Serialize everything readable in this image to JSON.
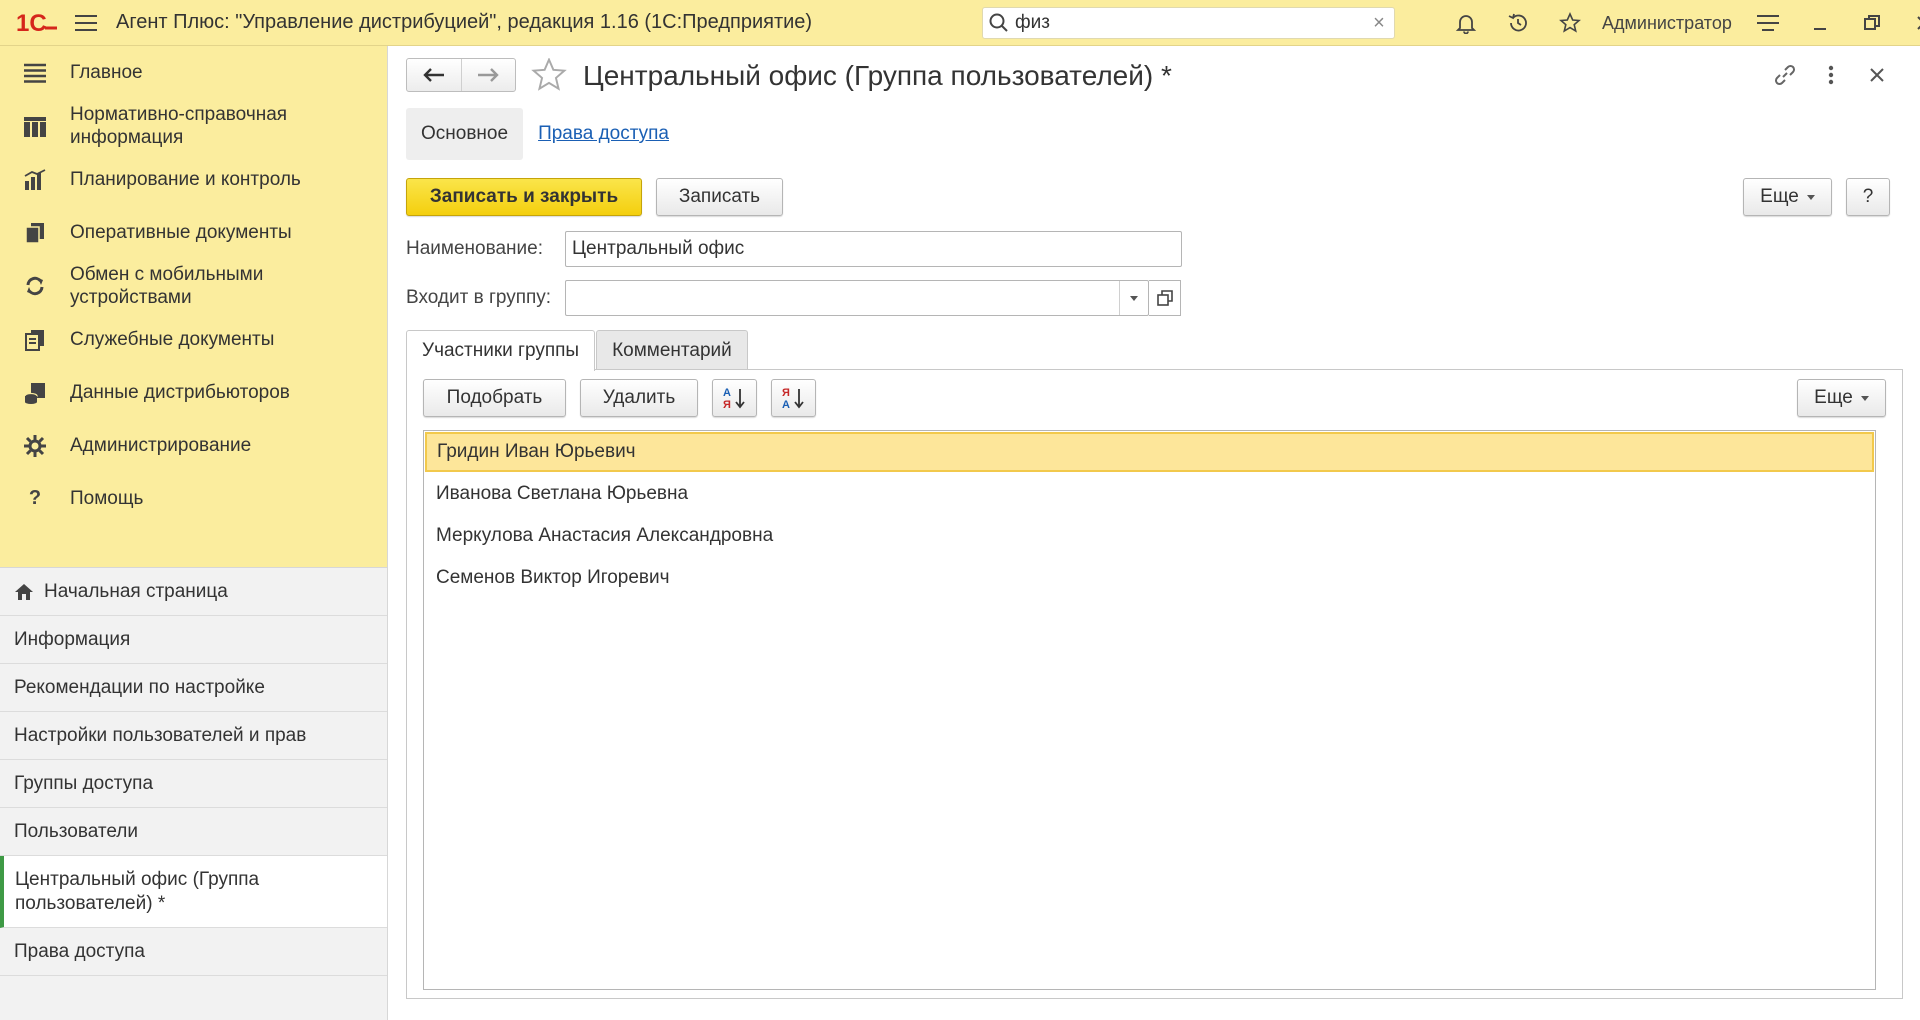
{
  "titlebar": {
    "logo": "1С",
    "title": "Агент Плюс: \"Управление дистрибуцией\", редакция 1.16  (1С:Предприятие)",
    "search_value": "физ",
    "user": "Администратор"
  },
  "sidebar": {
    "sections": [
      {
        "label": "Главное",
        "icon": "menu-lines-icon"
      },
      {
        "label": "Нормативно-справочная информация",
        "icon": "catalog-icon"
      },
      {
        "label": "Планирование и контроль",
        "icon": "chart-icon"
      },
      {
        "label": "Оперативные документы",
        "icon": "documents-icon"
      },
      {
        "label": "Обмен с мобильными устройствами",
        "icon": "sync-icon"
      },
      {
        "label": "Служебные документы",
        "icon": "service-docs-icon"
      },
      {
        "label": "Данные дистрибьюторов",
        "icon": "distributor-data-icon"
      },
      {
        "label": "Администрирование",
        "icon": "gear-icon"
      },
      {
        "label": "Помощь",
        "icon": "help-icon"
      }
    ],
    "open_windows": [
      {
        "label": "Начальная страница"
      },
      {
        "label": "Информация"
      },
      {
        "label": "Рекомендации по настройке"
      },
      {
        "label": "Настройки пользователей и прав"
      },
      {
        "label": "Группы доступа"
      },
      {
        "label": "Пользователи"
      },
      {
        "label": "Центральный офис (Группа пользователей) *"
      },
      {
        "label": "Права доступа"
      }
    ]
  },
  "form": {
    "title": "Центральный офис (Группа пользователей) *",
    "tabs": {
      "main": "Основное",
      "access": "Права доступа"
    },
    "buttons": {
      "save_close": "Записать и закрыть",
      "save": "Записать",
      "more": "Еще",
      "help": "?"
    },
    "fields": {
      "name_label": "Наименование:",
      "name_value": "Центральный офис",
      "group_label": "Входит в группу:",
      "group_value": ""
    },
    "inner_tabs": {
      "members": "Участники группы",
      "comment": "Комментарий"
    },
    "list_buttons": {
      "pick": "Подобрать",
      "delete": "Удалить",
      "more": "Еще"
    },
    "members": [
      "Гридин Иван Юрьевич",
      "Иванова Светлана Юрьевна",
      "Меркулова Анастасия Александровна",
      "Семенов Виктор Игоревич"
    ]
  },
  "colors": {
    "panel": "#fbed9e",
    "accent": "#f4cf0e",
    "link": "#1a5fb4",
    "active_marker": "#3e9a45",
    "selected_row": "#fde69a"
  }
}
